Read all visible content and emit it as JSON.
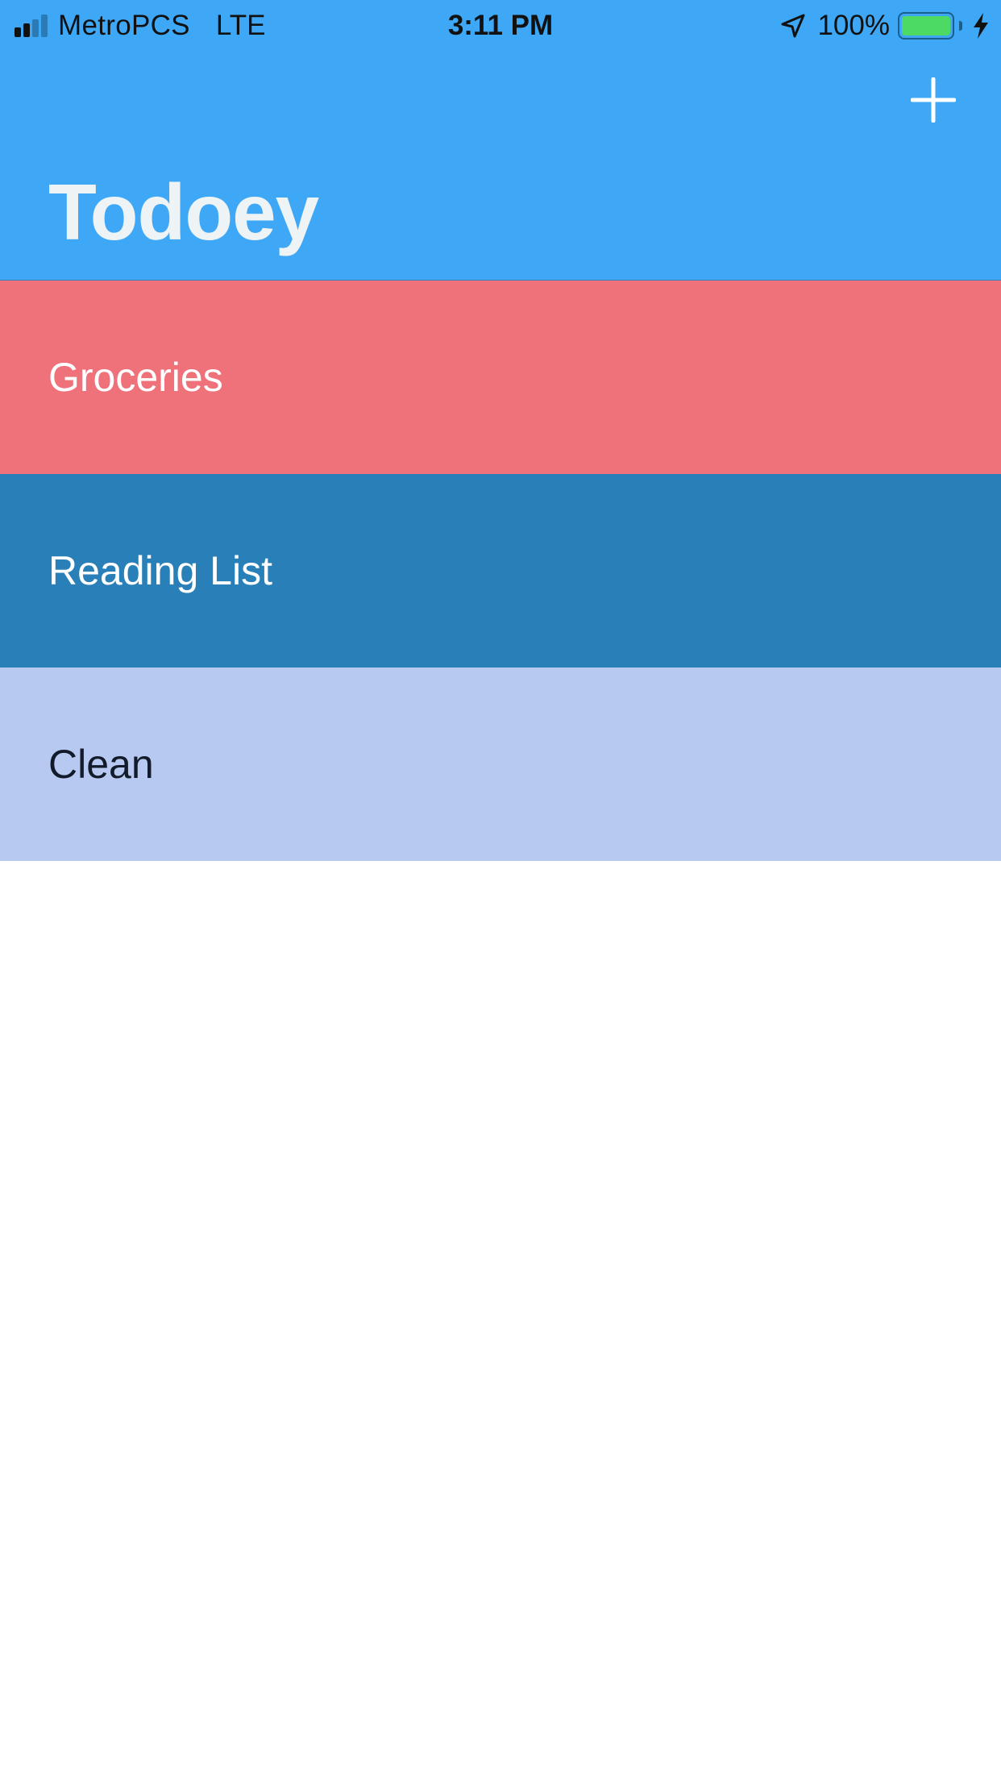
{
  "status_bar": {
    "carrier": "MetroPCS",
    "network": "LTE",
    "time": "3:11 PM",
    "battery_percent": "100%",
    "battery_level": 1.0,
    "signal_bars_filled": 2,
    "signal_bars_total": 4,
    "icons": [
      "signal-icon",
      "location-arrow-icon",
      "battery-icon",
      "charging-bolt-icon"
    ]
  },
  "nav": {
    "title": "Todoey",
    "add_icon": "plus-icon",
    "background_color": "#3fa8f6",
    "title_color": "#eef3f6"
  },
  "categories": [
    {
      "label": "Groceries",
      "background_color": "#ef717a",
      "text_color": "#ffffff"
    },
    {
      "label": "Reading List",
      "background_color": "#2980b9",
      "text_color": "#ffffff"
    },
    {
      "label": "Clean",
      "background_color": "#b8c9f1",
      "text_color": "#111b2a"
    }
  ]
}
